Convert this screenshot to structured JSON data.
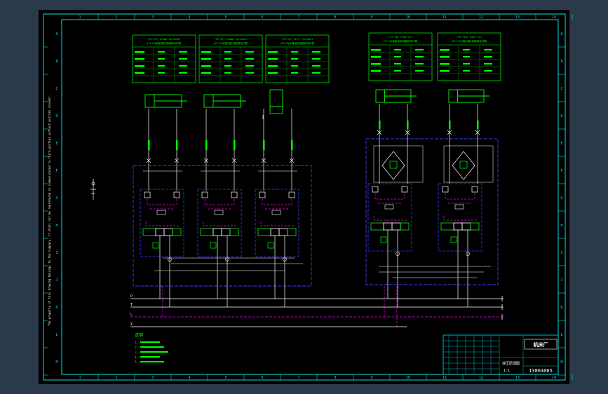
{
  "colors": {
    "background": "#000000",
    "window_bg": "#2b3a4a",
    "frame": "#00e5e5",
    "hydraulic_line": "#ffffff",
    "component": "#00ff00",
    "manifold_block": "#3a3aff",
    "pilot_line": "#ff00ff",
    "text": "#ffffff",
    "title_text": "#00ff00"
  },
  "border": {
    "top_ticks": [
      "1",
      "2",
      "3",
      "4",
      "5",
      "6",
      "7",
      "8",
      "9",
      "10",
      "11",
      "12",
      "13",
      "14"
    ],
    "side_ticks": [
      "A",
      "B",
      "C",
      "D",
      "E",
      "F",
      "G",
      "H",
      "I",
      "J",
      "K",
      "L",
      "M"
    ]
  },
  "tables": [
    {
      "title": "(Y1-Y2) Clamp cylinder",
      "subtitle": "(Y1-Y2)夹紧油缸电磁铁动作表"
    },
    {
      "title": "(Y3-Y4) Clamp cylinder",
      "subtitle": "(Y3-Y4)夹紧油缸电磁铁动作表"
    },
    {
      "title": "(Y5-Y6) Lift cylinder",
      "subtitle": "(Y5-Y6)升降油缸电磁铁动作表"
    },
    {
      "title": "(Y7-Y8) Feed cyl",
      "subtitle": "(Y7-Y8)进给油缸电磁铁动作表"
    },
    {
      "title": "(Y9-Y10) Feed cyl",
      "subtitle": "(Y9-Y10)进给油缸电磁铁动作表"
    }
  ],
  "lines": {
    "P": "P",
    "T": "T",
    "L": "L",
    "X": "X"
  },
  "vertical_note": "The property of this drawing belongs to the Company. It shall not be reproduced or communicated to third parties without written consent.",
  "notes": {
    "title": "说明",
    "items": [
      "1.",
      "2.",
      "3.",
      "4.",
      "5."
    ]
  },
  "title_block": {
    "company": "机床厂",
    "drawing_no": "13864065",
    "name": "液压原理图",
    "scale": "1:1"
  }
}
